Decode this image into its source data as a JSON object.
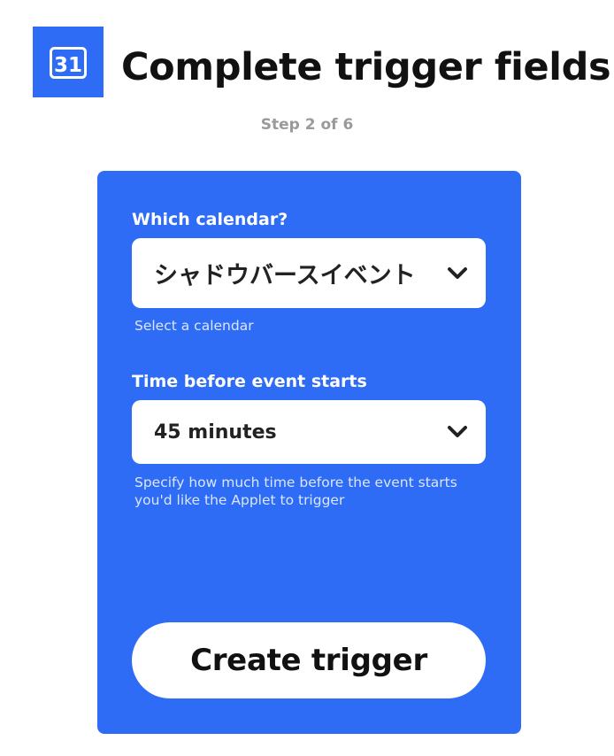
{
  "header": {
    "title": "Complete trigger fields",
    "service_icon_label": "31",
    "step": "Step 2 of 6"
  },
  "form": {
    "calendar": {
      "label": "Which calendar?",
      "selected": "シャドウバースイベント",
      "help": "Select a calendar"
    },
    "time_before": {
      "label": "Time before event starts",
      "selected": "45 minutes",
      "help": "Specify how much time before the event starts you'd like the Applet to trigger"
    },
    "submit_label": "Create trigger"
  },
  "colors": {
    "brand": "#2e6cf6",
    "card_background": "#2e6cf6",
    "button_background": "#ffffff",
    "muted_text": "#9a9a9a"
  },
  "icons": {
    "service": "google-calendar-icon",
    "dropdown": "chevron-down-icon"
  }
}
